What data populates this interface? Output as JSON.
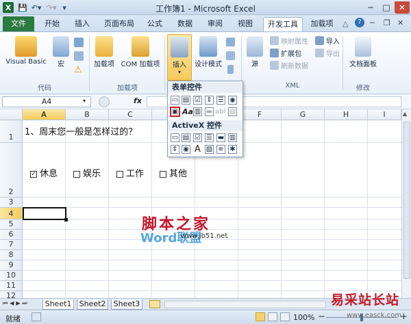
{
  "window": {
    "title": "工作簿1 - Microsoft Excel"
  },
  "tabs": [
    "文件",
    "开始",
    "插入",
    "页面布局",
    "公式",
    "数据",
    "审阅",
    "视图",
    "开发工具",
    "加载项"
  ],
  "ribbon": {
    "code_group": {
      "label": "代码",
      "visual_basic": "Visual Basic",
      "macro": "宏"
    },
    "addins_group": {
      "label": "加载项",
      "addins": "加载项",
      "com_addins": "COM 加载项"
    },
    "controls_group": {
      "insert": "插入",
      "design_mode": "设计模式"
    },
    "xml_group": {
      "label": "XML",
      "source": "源",
      "map_props": "映射属性",
      "expansion": "扩展包",
      "refresh": "刷新数据",
      "import": "导入",
      "export": "导出"
    },
    "modify_group": {
      "label": "修改",
      "doc_panel": "文档面板"
    }
  },
  "formula_bar": {
    "name_box": "A4",
    "fx": "fx"
  },
  "dropdown": {
    "form_controls": "表单控件",
    "activex_controls": "ActiveX 控件",
    "label_glyph": "Aa",
    "text_glyph": "abl",
    "a_glyph": "A"
  },
  "grid": {
    "columns": [
      "A",
      "B",
      "C",
      "D",
      "E",
      "F",
      "G",
      "H",
      "I"
    ],
    "rows": [
      "1",
      "2",
      "3",
      "4",
      "5",
      "6",
      "7",
      "8",
      "9",
      "10",
      "11",
      "12"
    ],
    "question": "1、周末您一般是怎样过的？",
    "options": [
      {
        "label": "休息",
        "checked": true
      },
      {
        "label": "娱乐",
        "checked": false
      },
      {
        "label": "工作",
        "checked": false
      },
      {
        "label": "其他",
        "checked": false
      }
    ]
  },
  "watermark": {
    "line1": "脚本之家",
    "line2": "Word联盟",
    "line3": "www.jb51.net",
    "line4": "易采站长站",
    "line5": "www.easck.com"
  },
  "sheets": [
    "Sheet1",
    "Sheet2",
    "Sheet3"
  ],
  "status": {
    "ready": "就绪",
    "zoom": "100%",
    "minus": "−",
    "plus": "+"
  },
  "colors": {
    "file_tab": "#2b7a3f",
    "selection": "#f5cb5c",
    "accent": "#2a4a7a"
  }
}
